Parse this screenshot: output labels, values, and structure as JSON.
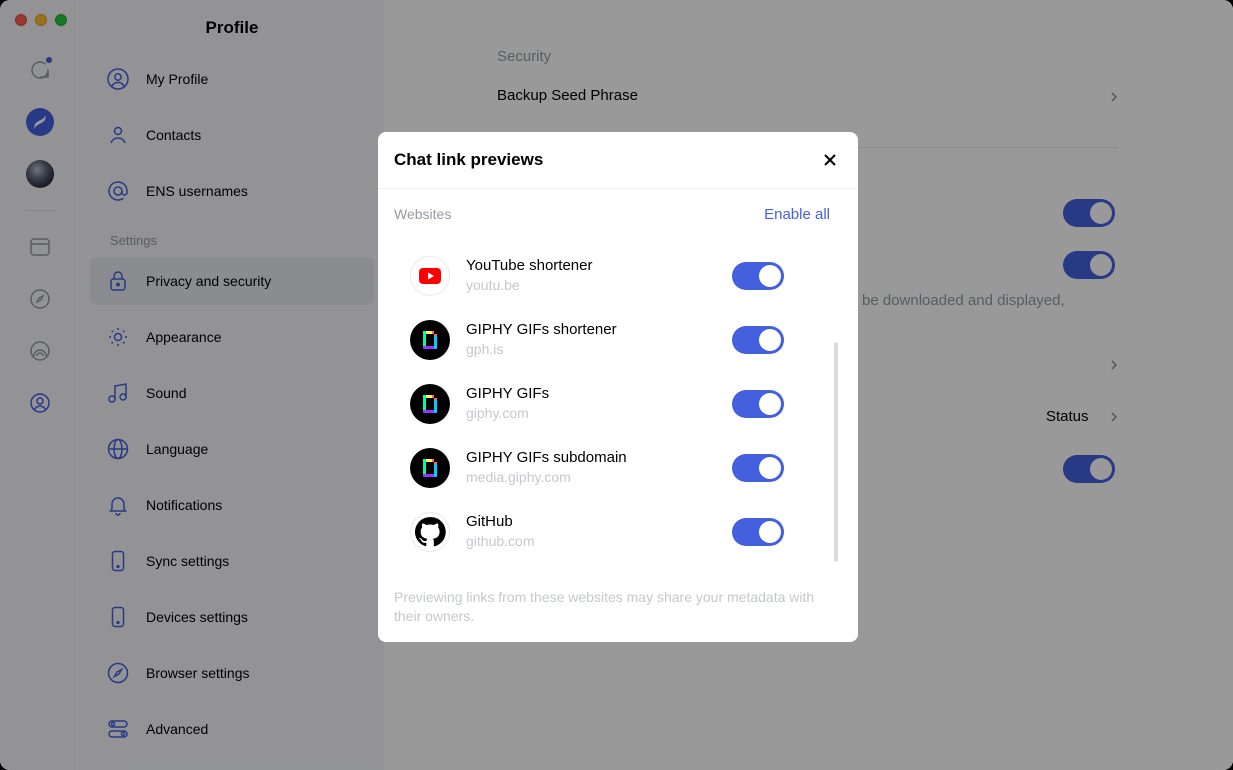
{
  "sidebar": {
    "title": "Profile",
    "section_settings": "Settings",
    "items": [
      {
        "label": "My Profile"
      },
      {
        "label": "Contacts"
      },
      {
        "label": "ENS usernames"
      },
      {
        "label": "Privacy and security"
      },
      {
        "label": "Appearance"
      },
      {
        "label": "Sound"
      },
      {
        "label": "Language"
      },
      {
        "label": "Notifications"
      },
      {
        "label": "Sync settings"
      },
      {
        "label": "Devices settings"
      },
      {
        "label": "Browser settings"
      },
      {
        "label": "Advanced"
      }
    ]
  },
  "main": {
    "security": "Security",
    "backup": "Backup Seed Phrase",
    "downloaded_text": "be downloaded and displayed,",
    "status": "Status"
  },
  "modal": {
    "title": "Chat link previews",
    "section": "Websites",
    "enable_all": "Enable all",
    "sites": [
      {
        "name": "YouTube shortener",
        "domain": "youtu.be",
        "enabled": true
      },
      {
        "name": "GIPHY GIFs shortener",
        "domain": "gph.is",
        "enabled": true
      },
      {
        "name": "GIPHY GIFs",
        "domain": "giphy.com",
        "enabled": true
      },
      {
        "name": "GIPHY GIFs subdomain",
        "domain": "media.giphy.com",
        "enabled": true
      },
      {
        "name": "GitHub",
        "domain": "github.com",
        "enabled": true
      }
    ],
    "footnote": "Previewing links from these websites may share your metadata with their owners."
  },
  "colors": {
    "accent": "#4360df",
    "muted": "#939ba1"
  }
}
